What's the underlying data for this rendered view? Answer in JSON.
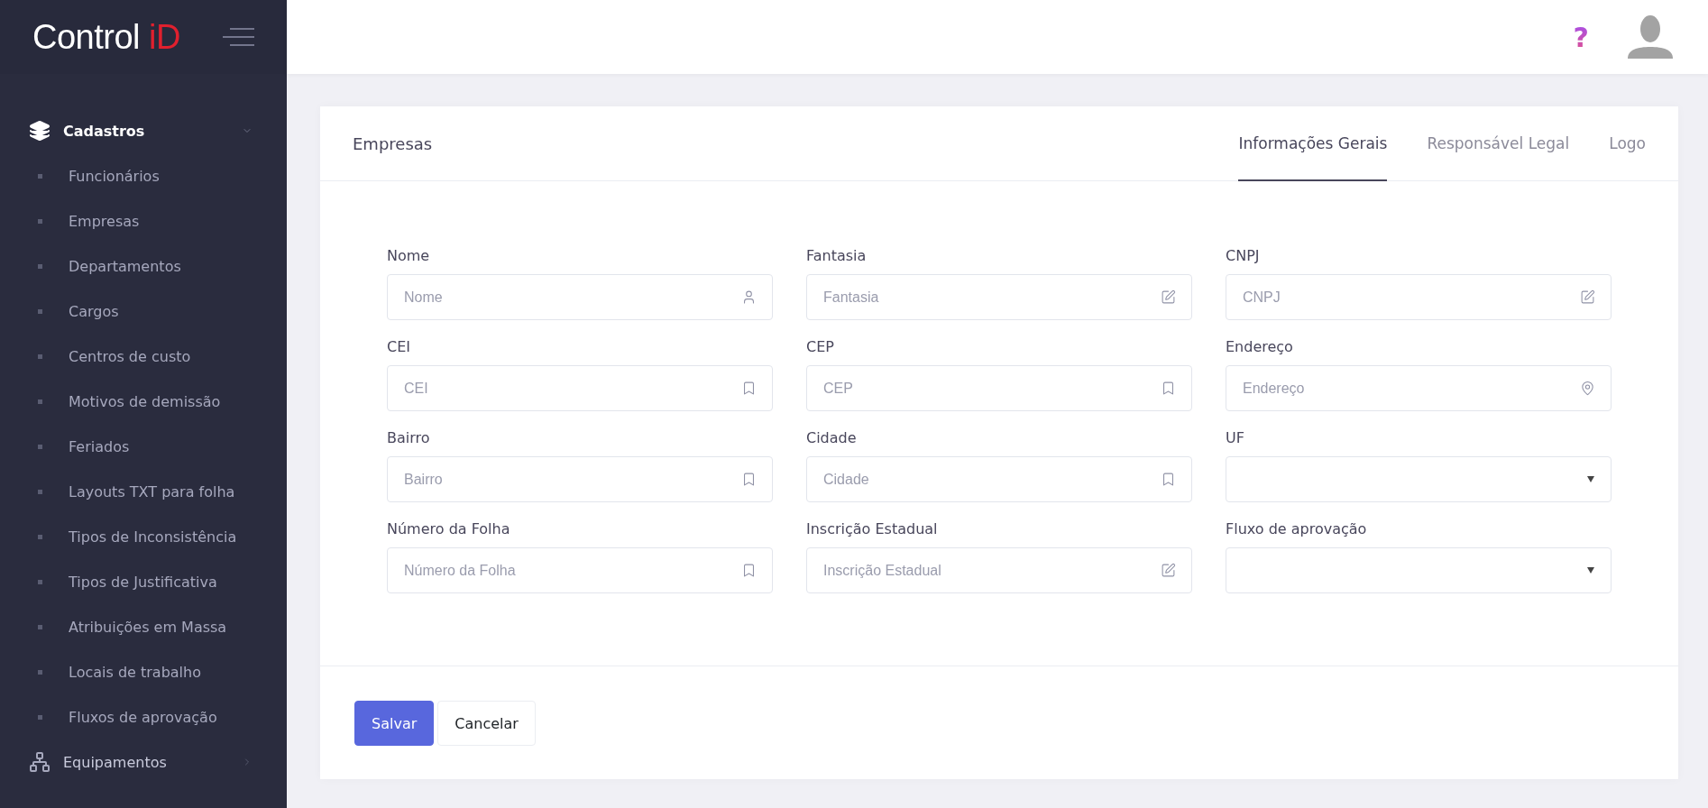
{
  "logo": {
    "text": "Control",
    "accent": "iD"
  },
  "sidebar": {
    "items": [
      {
        "label": "Cadastros",
        "kind": "layers",
        "expanded": true,
        "children": [
          {
            "label": "Funcionários"
          },
          {
            "label": "Empresas"
          },
          {
            "label": "Departamentos"
          },
          {
            "label": "Cargos"
          },
          {
            "label": "Centros de custo"
          },
          {
            "label": "Motivos de demissão"
          },
          {
            "label": "Feriados"
          },
          {
            "label": "Layouts TXT para folha"
          },
          {
            "label": "Tipos de Inconsistência"
          },
          {
            "label": "Tipos de Justificativa"
          },
          {
            "label": "Atribuições em Massa"
          },
          {
            "label": "Locais de trabalho"
          },
          {
            "label": "Fluxos de aprovação"
          }
        ]
      },
      {
        "label": "Equipamentos",
        "kind": "sitemap",
        "expanded": false
      }
    ]
  },
  "header": {
    "help": "?"
  },
  "card": {
    "title": "Empresas",
    "tabs": [
      {
        "label": "Informações Gerais",
        "selected": true
      },
      {
        "label": "Responsável Legal",
        "selected": false
      },
      {
        "label": "Logo",
        "selected": false
      }
    ],
    "fields": [
      {
        "label": "Nome",
        "kind": "user",
        "placeholder": "Nome"
      },
      {
        "label": "Fantasia",
        "kind": "edit",
        "placeholder": "Fantasia"
      },
      {
        "label": "CNPJ",
        "kind": "edit",
        "placeholder": "CNPJ"
      },
      {
        "label": "CEI",
        "kind": "bookmark",
        "placeholder": "CEI"
      },
      {
        "label": "CEP",
        "kind": "bookmark",
        "placeholder": "CEP"
      },
      {
        "label": "Endereço",
        "kind": "pin",
        "placeholder": "Endereço"
      },
      {
        "label": "Bairro",
        "kind": "bookmark",
        "placeholder": "Bairro"
      },
      {
        "label": "Cidade",
        "kind": "bookmark",
        "placeholder": "Cidade"
      },
      {
        "label": "UF",
        "kind": "select"
      },
      {
        "label": "Número da Folha",
        "kind": "bookmark",
        "placeholder": "Número da Folha"
      },
      {
        "label": "Inscrição Estadual",
        "kind": "edit",
        "placeholder": "Inscrição Estadual"
      },
      {
        "label": "Fluxo de aprovação",
        "kind": "select"
      }
    ],
    "buttons": [
      {
        "label": "Salvar",
        "kind": "primary"
      },
      {
        "label": "Cancelar",
        "kind": "secondary"
      }
    ]
  }
}
